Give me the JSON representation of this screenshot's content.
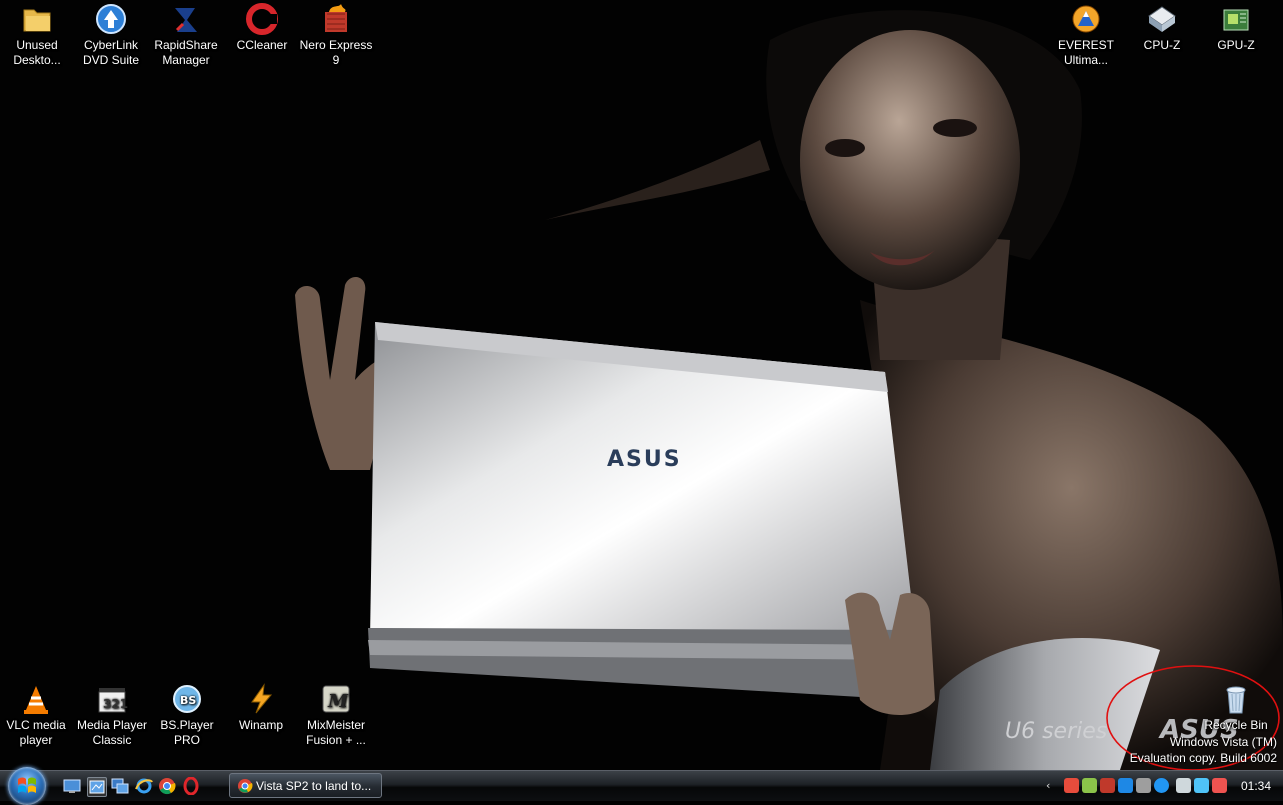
{
  "desktop": {
    "top_icons": [
      {
        "label": "Unused\nDeskto...",
        "icon": "folder-icon"
      },
      {
        "label": "CyberLink\nDVD Suite",
        "icon": "cyberlink-icon"
      },
      {
        "label": "RapidShare\nManager",
        "icon": "rapidshare-icon"
      },
      {
        "label": "CCleaner",
        "icon": "ccleaner-icon"
      },
      {
        "label": "Nero Express\n9",
        "icon": "nero-icon"
      },
      {
        "label": "EVEREST\nUltima...",
        "icon": "everest-icon"
      },
      {
        "label": "CPU-Z",
        "icon": "cpuz-icon"
      },
      {
        "label": "GPU-Z",
        "icon": "gpuz-icon"
      }
    ],
    "bottom_icons": [
      {
        "label": "VLC media\nplayer",
        "icon": "vlc-icon"
      },
      {
        "label": "Media Player\nClassic",
        "icon": "mpc-icon"
      },
      {
        "label": "BS.Player\nPRO",
        "icon": "bsplayer-icon"
      },
      {
        "label": "Winamp",
        "icon": "winamp-icon"
      },
      {
        "label": "MixMeister\nFusion + ...",
        "icon": "mixmeister-icon"
      },
      {
        "label": "Recycle Bin",
        "icon": "recycle-bin-icon"
      }
    ],
    "wallpaper": {
      "brand": "ASUS",
      "series": "U6 series"
    },
    "watermark": {
      "line1": "Windows Vista (TM)",
      "line2": "Evaluation copy. Build 6002"
    }
  },
  "taskbar": {
    "start_icon": "windows-start-orb-icon",
    "quick_launch": [
      "show-desktop-icon",
      "explorer-icon",
      "switch-windows-icon",
      "internet-explorer-icon",
      "chrome-icon",
      "opera-icon"
    ],
    "active_window": "Vista SP2 to land to...",
    "clock": "01:34"
  },
  "colors": {
    "annotation_circle": "#e01010",
    "taskbar": "#1d2126",
    "desktop": "#020202"
  }
}
